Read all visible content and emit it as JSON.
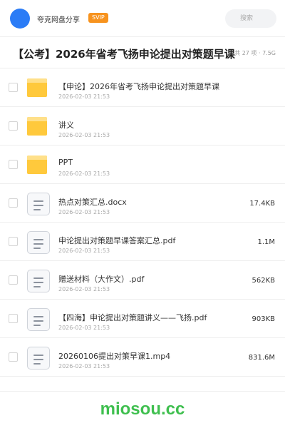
{
  "header": {
    "username": "夸克网盘分享",
    "badge": "SVIP",
    "search_placeholder": "搜索"
  },
  "share": {
    "title": "【公考】2026年省考飞扬申论提出对策题早课",
    "meta": "共 27 项 · 7.5G"
  },
  "files": [
    {
      "type": "folder",
      "name": "【申论】2026年省考飞扬申论提出对策题早课",
      "date": "2026-02-03 21:53",
      "size": ""
    },
    {
      "type": "folder",
      "name": "讲义",
      "date": "2026-02-03 21:53",
      "size": ""
    },
    {
      "type": "folder",
      "name": "PPT",
      "date": "2026-02-03 21:53",
      "size": ""
    },
    {
      "type": "file",
      "name": "热点对策汇总.docx",
      "date": "2026-02-03 21:53",
      "size": "17.4KB"
    },
    {
      "type": "file",
      "name": "申论提出对策题早课答案汇总.pdf",
      "date": "2026-02-03 21:53",
      "size": "1.1M"
    },
    {
      "type": "file",
      "name": "赠送材料（大作文）.pdf",
      "date": "2026-02-03 21:53",
      "size": "562KB"
    },
    {
      "type": "file",
      "name": "【四海】申论提出对策题讲义——飞扬.pdf",
      "date": "2026-02-03 21:53",
      "size": "903KB"
    },
    {
      "type": "file",
      "name": "20260106提出对策早课1.mp4",
      "date": "2026-02-03 21:53",
      "size": "831.6M"
    }
  ],
  "icons": {
    "folder": "folder-icon",
    "file": "document-icon"
  },
  "colors": {
    "accent": "#2b7cf6",
    "badge": "#f7931e",
    "folder": "#ffc93c",
    "watermark": "#3fbf4f"
  },
  "footer": {
    "watermark": "miosou.cc"
  }
}
